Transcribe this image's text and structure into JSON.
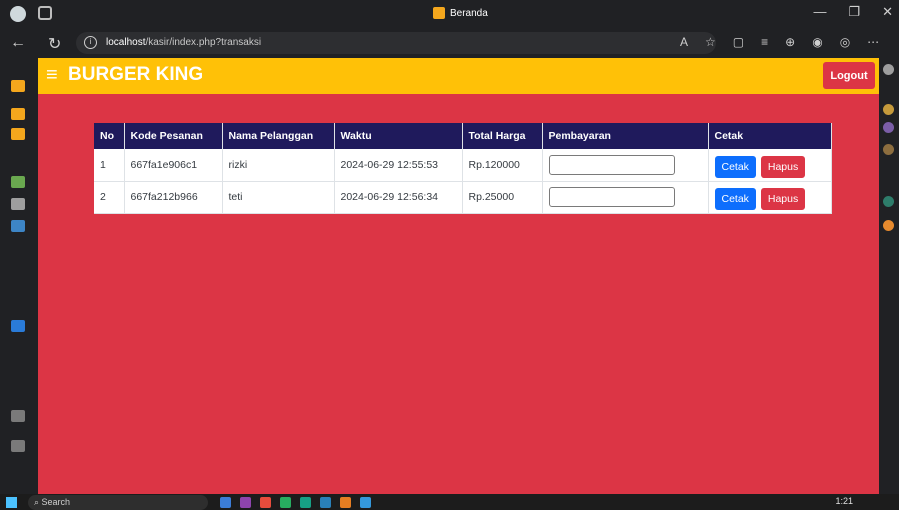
{
  "browser": {
    "tab_title": "Beranda",
    "url_host": "localhost",
    "url_path": "/kasir/index.php?transaksi",
    "window_controls": [
      "—",
      "❐",
      "✕"
    ]
  },
  "navbar": {
    "brand": "BURGER KING",
    "logout_label": "Logout"
  },
  "table": {
    "headers": [
      "No",
      "Kode Pesanan",
      "Nama Pelanggan",
      "Waktu",
      "Total Harga",
      "Pembayaran",
      "Cetak"
    ],
    "rows": [
      {
        "no": "1",
        "kode": "667fa1e906c1",
        "nama": "rizki",
        "waktu": "2024-06-29 12:55:53",
        "total": "Rp.120000",
        "pembayaran": "",
        "cetak_label": "Cetak",
        "hapus_label": "Hapus"
      },
      {
        "no": "2",
        "kode": "667fa212b966",
        "nama": "teti",
        "waktu": "2024-06-29 12:56:34",
        "total": "Rp.25000",
        "pembayaran": "",
        "cetak_label": "Cetak",
        "hapus_label": "Hapus"
      }
    ]
  },
  "taskbar": {
    "search_label": "Search",
    "time": "1:21"
  },
  "colors": {
    "navbar": "#ffc107",
    "page_bg": "#dc3545",
    "table_header": "#1f1a5c",
    "cetak_button": "#0d6efd",
    "hapus_button": "#dc3545"
  }
}
